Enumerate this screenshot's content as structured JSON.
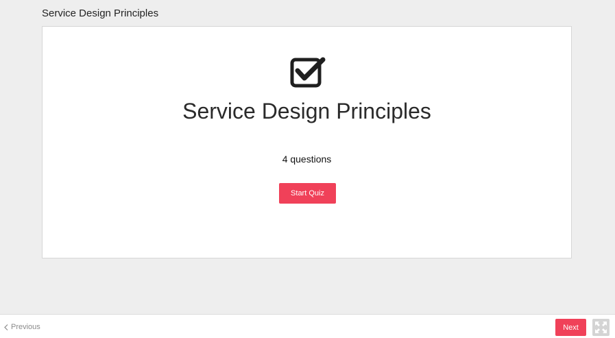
{
  "page": {
    "title": "Service Design Principles"
  },
  "quiz": {
    "icon": "checkbox-checked-icon",
    "title": "Service Design Principles",
    "question_count": "4 questions",
    "start_label": "Start Quiz"
  },
  "footer": {
    "previous_label": "Previous",
    "next_label": "Next",
    "fullscreen_icon": "expand-icon"
  },
  "colors": {
    "accent": "#f04159",
    "background": "#eeeeee",
    "card": "#ffffff"
  }
}
